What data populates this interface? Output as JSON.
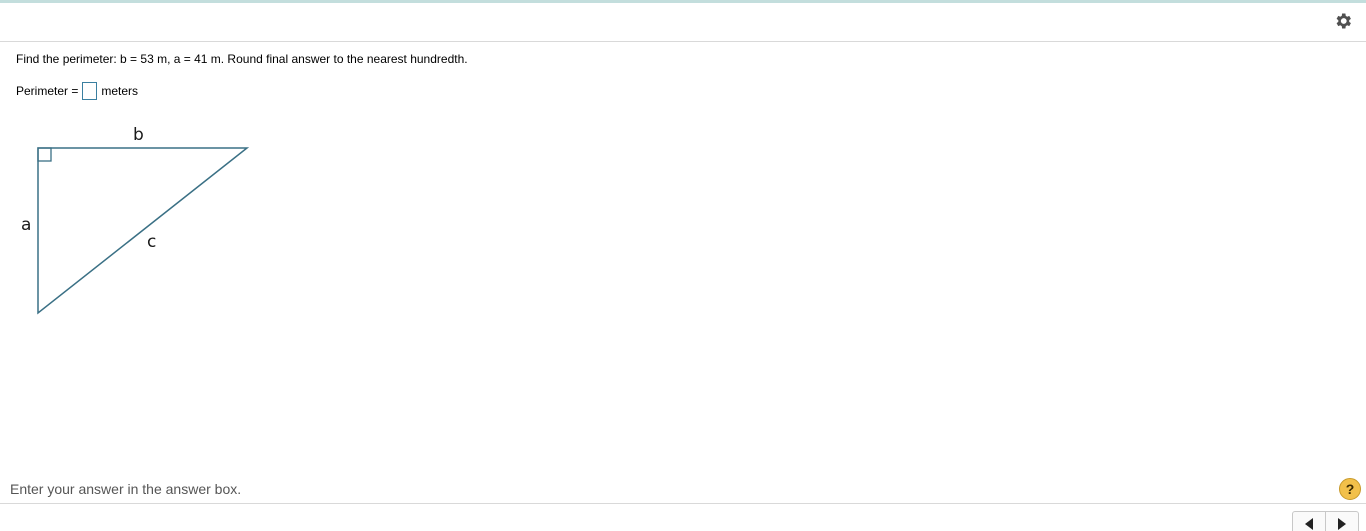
{
  "header": {
    "settings_icon": "gear-icon"
  },
  "question": {
    "prompt": "Find the perimeter: b = 53 m, a = 41 m. Round final answer to the nearest hundredth.",
    "answer_label": "Perimeter =",
    "answer_value": "",
    "unit": "meters"
  },
  "figure": {
    "label_a": "a",
    "label_b": "b",
    "label_c": "c",
    "stroke_color": "#3a7085"
  },
  "footer": {
    "instruction": "Enter your answer in the answer box.",
    "help_label": "?",
    "prev_icon": "triangle-left-icon",
    "next_icon": "triangle-right-icon"
  }
}
